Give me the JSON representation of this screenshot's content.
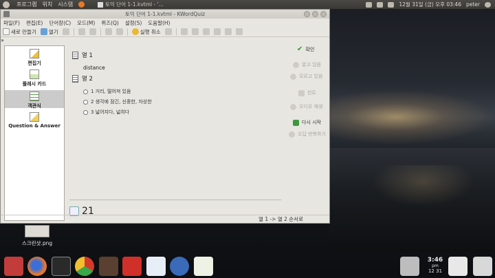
{
  "top_panel": {
    "menus": [
      "프로그램",
      "위치",
      "시스템"
    ],
    "task_title": "토익 단어 1-1.kvtml - '...",
    "datetime": "12월 31일 (금) 오후 03:46",
    "user": "peter"
  },
  "window": {
    "title": "토익 단어 1-1.kvtml - KWordQuiz",
    "menu": [
      "파일(F)",
      "편집(E)",
      "단어장(C)",
      "모드(M)",
      "퀴즈(Q)",
      "설정(S)",
      "도움말(H)"
    ],
    "toolbar": {
      "new_label": "새로 만들기",
      "open_label": "열기",
      "undo_label": "실행 취소",
      "more": "»"
    }
  },
  "sidebar": {
    "items": [
      {
        "label": "편집기"
      },
      {
        "label": "플래시 카드"
      },
      {
        "label": "객관식"
      },
      {
        "label": "Question & Answer"
      }
    ]
  },
  "quiz": {
    "col1_label": "열 1",
    "word": "distance",
    "col2_label": "열 2",
    "options": [
      "1 거리, 떨어져 있음",
      "2 생각에 잠긴, 신중한, 자상한",
      "3 넓어지다, 넓히다"
    ],
    "count": "21"
  },
  "actions": {
    "check": "확인",
    "know": "알고 있음",
    "dont_know": "모르고 있음",
    "hint": "힌트",
    "audio": "오디오 재생",
    "restart": "다시 시작",
    "repeat_errors": "오답 반복하기"
  },
  "status": "열 1 -> 열 2 순서로",
  "desktop": {
    "file_label": "스크린샷.png"
  },
  "clock": {
    "time": "3:46",
    "ampm": "pm",
    "date": "12 31"
  }
}
